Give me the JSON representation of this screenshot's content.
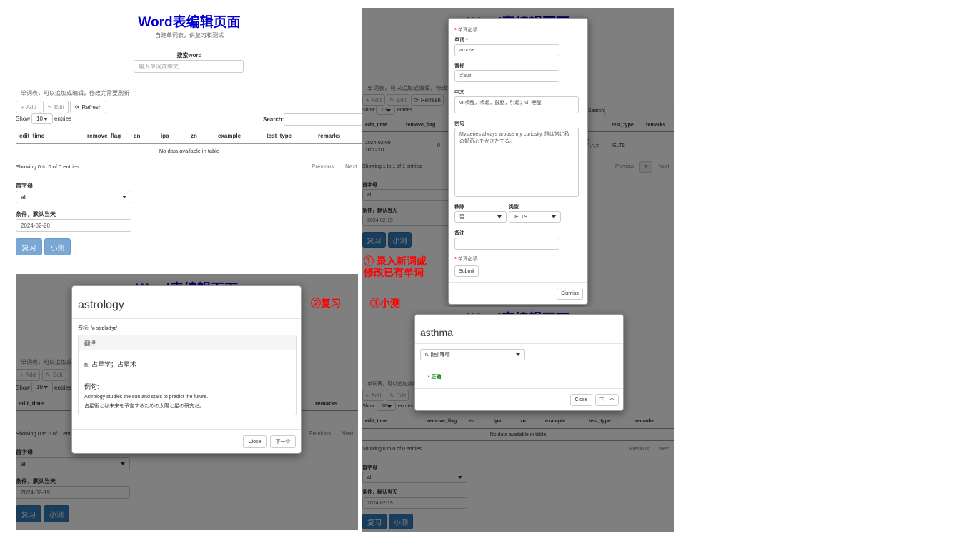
{
  "page": {
    "title": "Word表编辑页面",
    "subtitle": "自建单词表，供复习和测试",
    "search_label": "搜索word",
    "search_placeholder": "输入单词或中文...",
    "table_desc": "单词表，可以追加或编辑，修改完需要刷新"
  },
  "toolbar": {
    "add": "Add",
    "edit": "Edit",
    "refresh": "Refresh"
  },
  "dt": {
    "show": "Show",
    "entries": "entries",
    "length": "10",
    "search": "Search:",
    "columns": [
      "edit_time",
      "remove_flag",
      "en",
      "ipa",
      "zn",
      "example",
      "test_type",
      "remarks"
    ],
    "empty": "No data available in table",
    "info_empty": "Showing 0 to 0 of 0 entries",
    "info_one": "Showing 1 to 1 of 1 entries",
    "previous": "Previous",
    "next": "Next",
    "page1": "1"
  },
  "filters": {
    "initial_label": "首字母",
    "initial_value": "all",
    "cond_label": "条件，默认当天",
    "date_main": "2024-02-20",
    "date_other": "2024-02-19"
  },
  "actions": {
    "review": "复习",
    "quiz": "小测"
  },
  "edit_table_row": {
    "edit_time_1": "2024-02-08",
    "edit_time_2": "10:12:01",
    "remove_flag": "0",
    "example_1": "ry",
    "example_2": "奇心を",
    "test_type": "IELTS"
  },
  "form": {
    "required_note": "单词必填",
    "word_label": "单词",
    "required_star": "*",
    "word_value": "arouse",
    "ipa_label": "音标",
    "ipa_value": "ə'auz",
    "zn_label": "中文",
    "zn_value": "vt 唤醒，唤起，鼓励，引起；vi. 睡醒",
    "example_label": "例句",
    "example_value": "Mysteries always arouse my curiosity. 謎は常に私の好奇心をかきたてる。",
    "remove_label": "移除",
    "remove_value": "否",
    "type_label": "类型",
    "type_value": "IELTS",
    "remarks_label": "备注",
    "required_note2": "单词必填",
    "submit": "Submit",
    "dismiss": "Dismiss"
  },
  "review_modal": {
    "word": "astrology",
    "ipa": "音标: /ə strɒlədʒɪ/",
    "trans_header": "翻译",
    "meaning": "n. 占星学；占星术",
    "example_label": "例句:",
    "example_en": "Astrology studies the sun and stars to predict the future.",
    "example_ja": "占星術とは未来を予言するための太陽と星の研究だ。",
    "close": "Close",
    "next": "下一个"
  },
  "quiz_modal": {
    "word": "asthma",
    "option": "n. [医] 哮喘",
    "result": "正确",
    "close": "Close",
    "next": "下一个"
  },
  "annotations": {
    "a1_line1": "① 录入新词或",
    "a1_line2": "修改已有单词",
    "a2": "②复习",
    "a3": "③小测"
  },
  "colors": {
    "title": "#0000cc",
    "primary": "#337ab7",
    "annotation": "#ff0000",
    "correct": "#008000"
  }
}
